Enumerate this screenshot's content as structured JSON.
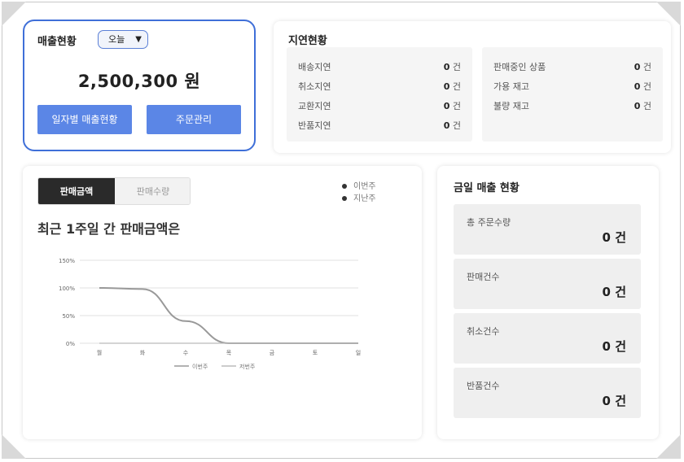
{
  "sales": {
    "title": "매출현황",
    "period": "오늘",
    "amount": "2,500,300 원",
    "daily_button": "일자별 매출현황",
    "order_button": "주문관리"
  },
  "delay": {
    "title": "지연현황",
    "left": [
      {
        "label": "배송지연",
        "count": "0",
        "unit": "건"
      },
      {
        "label": "취소지연",
        "count": "0",
        "unit": "건"
      },
      {
        "label": "교환지연",
        "count": "0",
        "unit": "건"
      },
      {
        "label": "반품지연",
        "count": "0",
        "unit": "건"
      }
    ],
    "right": [
      {
        "label": "판매중인 상품",
        "count": "0",
        "unit": "건"
      },
      {
        "label": "가용 재고",
        "count": "0",
        "unit": "건"
      },
      {
        "label": "불량 재고",
        "count": "0",
        "unit": "건"
      }
    ]
  },
  "chart_panel": {
    "tab_amount": "판매금액",
    "tab_quantity": "판매수량",
    "legend_this_week": "이번주",
    "legend_last_week": "지난주",
    "headline": "최근 1주일 간 판매금액은"
  },
  "chart_data": {
    "type": "line",
    "categories": [
      "월",
      "화",
      "수",
      "목",
      "금",
      "토",
      "일"
    ],
    "y_ticks": [
      "0%",
      "50%",
      "100%",
      "150%"
    ],
    "ylim": [
      0,
      150
    ],
    "series": [
      {
        "name": "이번주",
        "values": [
          100,
          98,
          40,
          0,
          0,
          0,
          0
        ]
      },
      {
        "name": "저번주",
        "values": [
          0,
          0,
          0,
          0,
          0,
          0,
          0
        ]
      }
    ],
    "grid": true,
    "legend": "bottom"
  },
  "today": {
    "title": "금일 매출 현황",
    "stats": [
      {
        "label": "총 주문수량",
        "value": "0 건"
      },
      {
        "label": "판매건수",
        "value": "0 건"
      },
      {
        "label": "취소건수",
        "value": "0 건"
      },
      {
        "label": "반품건수",
        "value": "0 건"
      }
    ]
  }
}
